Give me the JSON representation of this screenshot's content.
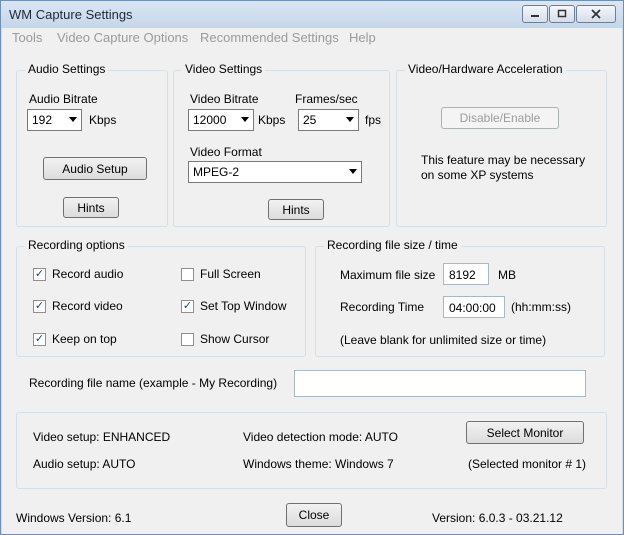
{
  "window": {
    "title": "WM Capture Settings"
  },
  "menu": [
    "Tools",
    "Video Capture Options",
    "Recommended Settings",
    "Help"
  ],
  "audio_settings": {
    "title": "Audio Settings",
    "bitrate_label": "Audio Bitrate",
    "bitrate_value": "192",
    "bitrate_unit": "Kbps",
    "setup_button": "Audio Setup",
    "hints_button": "Hints"
  },
  "video_settings": {
    "title": "Video Settings",
    "bitrate_label": "Video Bitrate",
    "bitrate_value": "12000",
    "bitrate_unit": "Kbps",
    "fps_label": "Frames/sec",
    "fps_value": "25",
    "fps_unit": "fps",
    "format_label": "Video Format",
    "format_value": "MPEG-2",
    "hints_button": "Hints"
  },
  "acceleration": {
    "title": "Video/Hardware Acceleration",
    "button": "Disable/Enable",
    "note_line1": "This feature may be necessary",
    "note_line2": "on some XP systems"
  },
  "recording_options": {
    "title": "Recording options",
    "record_audio": {
      "label": "Record audio",
      "checked": true,
      "mark": "✓"
    },
    "record_video": {
      "label": "Record video",
      "checked": true,
      "mark": "✓"
    },
    "keep_on_top": {
      "label": "Keep on top",
      "checked": true,
      "mark": "✓"
    },
    "full_screen": {
      "label": "Full Screen",
      "checked": false,
      "mark": ""
    },
    "set_top_window": {
      "label": "Set Top Window",
      "checked": true,
      "mark": "✓"
    },
    "show_cursor": {
      "label": "Show Cursor",
      "checked": false,
      "mark": ""
    }
  },
  "file_size": {
    "title": "Recording file size / time",
    "max_size_label": "Maximum file size",
    "max_size_value": "8192",
    "max_size_unit": "MB",
    "time_label": "Recording Time",
    "time_value": "04:00:00",
    "time_unit": "(hh:mm:ss)",
    "note": "(Leave blank for unlimited size or time)"
  },
  "file_name": {
    "label": "Recording file name (example -  My Recording)",
    "value": ""
  },
  "info": {
    "video_setup": "Video setup: ENHANCED",
    "audio_setup": "Audio setup: AUTO",
    "detection_mode": "Video detection mode: AUTO",
    "windows_theme": "Windows theme: Windows 7",
    "select_monitor_button": "Select Monitor",
    "selected_monitor": "(Selected monitor # 1)"
  },
  "footer": {
    "windows_version": "Windows Version: 6.1",
    "close_button": "Close",
    "version": "Version: 6.0.3 - 03.21.12"
  },
  "icons": {
    "minimize": "minimize-icon",
    "maximize": "maximize-icon",
    "close": "close-icon",
    "dropdown": "chevron-down-icon"
  }
}
